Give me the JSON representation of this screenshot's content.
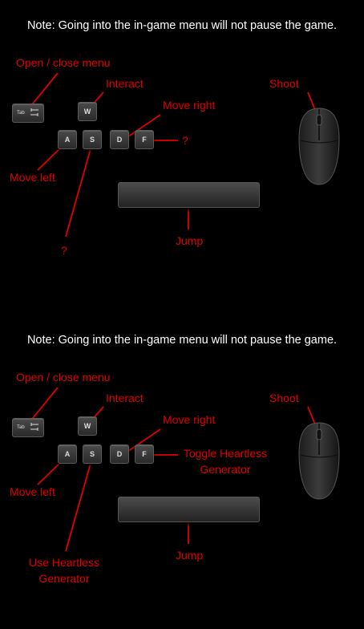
{
  "panels": [
    {
      "note": "Note: Going into the in-game menu will not pause the game.",
      "labels": {
        "menu": "Open / close menu",
        "interact": "Interact",
        "move_right": "Move right",
        "shoot": "Shoot",
        "f_action": "?",
        "move_left": "Move left",
        "s_action": "?",
        "jump": "Jump"
      }
    },
    {
      "note": "Note: Going into the in-game menu will not pause the game.",
      "labels": {
        "menu": "Open / close menu",
        "interact": "Interact",
        "move_right": "Move right",
        "shoot": "Shoot",
        "f_action": "Toggle Heartless Generator",
        "move_left": "Move left",
        "s_action": "Use Heartless Generator",
        "jump": "Jump"
      }
    }
  ],
  "keys": {
    "tab": "Tab",
    "w": "W",
    "a": "A",
    "s": "S",
    "d": "D",
    "f": "F"
  },
  "colors": {
    "background": "#000000",
    "label": "#e00000",
    "note": "#ffffff"
  },
  "icons": {
    "mouse": "mouse-icon",
    "tab_arrows": "tab-arrows-icon"
  }
}
